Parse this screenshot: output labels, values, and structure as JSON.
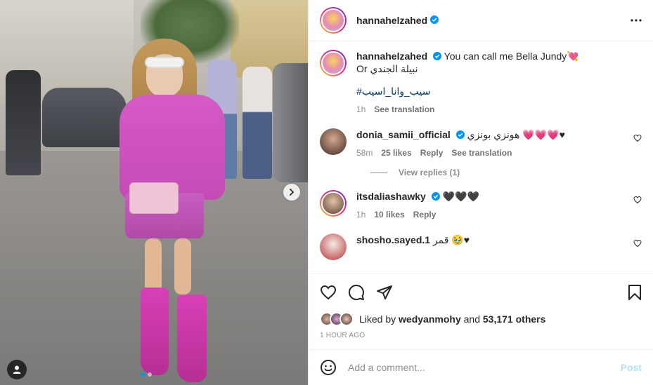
{
  "post": {
    "author": "hannahelzahed",
    "caption_line1": "You can call me Bella Jundy💘",
    "caption_line2": "Or نبيلة الجندي",
    "hashtag": "#سيب_وانا_اسيب",
    "time": "1h",
    "see_translation": "See translation"
  },
  "comments": [
    {
      "user": "donia_samii_official",
      "text": "هونزي بونزي 💗💗💗♥",
      "time": "58m",
      "likes": "25 likes",
      "reply": "Reply",
      "see_translation": "See translation"
    },
    {
      "user": "itsdaliashawky",
      "text": "🖤🖤🖤",
      "time": "1h",
      "likes": "10 likes",
      "reply": "Reply"
    },
    {
      "user": "shosho.sayed.1",
      "text": "قمر 🥹♥"
    }
  ],
  "view_replies": "View replies (1)",
  "liked_by": {
    "prefix": "Liked by",
    "user": "wedyanmohy",
    "and": "and",
    "others": "53,171 others"
  },
  "timestamp": "1 HOUR AGO",
  "add_comment": {
    "placeholder": "Add a comment...",
    "post_label": "Post"
  },
  "colors": {
    "accent": "#0095f6",
    "verified": "#0095f6",
    "link": "#00376b"
  },
  "icons": {
    "next": "chevron-right-icon",
    "tag": "user-tag-icon",
    "more": "more-horizontal-icon",
    "like": "heart-icon",
    "comment": "comment-icon",
    "share": "send-icon",
    "save": "bookmark-icon",
    "emoji": "emoji-icon"
  }
}
